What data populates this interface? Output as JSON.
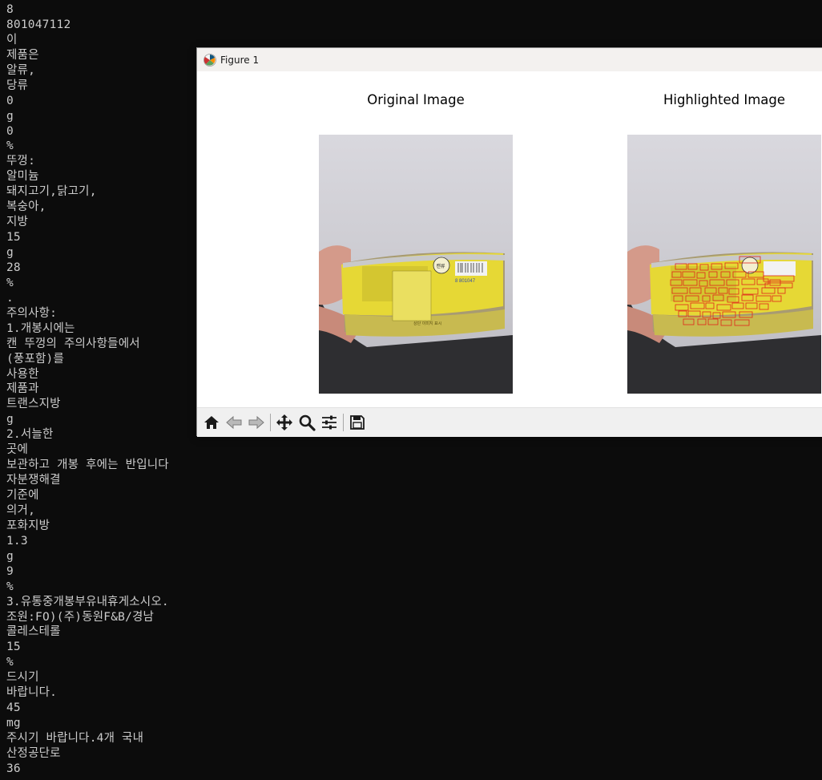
{
  "terminal": {
    "lines": [
      "8",
      "801047112",
      "이",
      "제품은",
      "알류,",
      "당류",
      "0",
      "g",
      "0",
      "%",
      "뚜껑:",
      "알미늄",
      "돼지고기,닭고기,",
      "복숭아,",
      "지방",
      "15",
      "g",
      "28",
      "%",
      ".",
      "주의사항:",
      "1.개봉시에는",
      "캔 뚜껑의 주의사항들에서",
      "(풍포함)를",
      "사용한",
      "제품과",
      "트랜스지방",
      "g",
      "2.서늘한",
      "곳에",
      "보관하고 개봉 후에는 반입니다",
      "자분쟁해결",
      "기준에",
      "의거,",
      "포화지방",
      "1.3",
      "g",
      "9",
      "%",
      "3.유통중개봉부유내휴게소시오.",
      "조원:FO)(주)동원F&B/경남",
      "콜레스테롤",
      "15",
      "%",
      "드시기",
      "바랍니다.",
      "45",
      "mg",
      "주시기 바랍니다.4개 국내",
      "산정공단로",
      "36"
    ]
  },
  "figure": {
    "window_title": "Figure 1",
    "app_icon": "matplotlib-figure-icon",
    "subplots": [
      {
        "title": "Original Image"
      },
      {
        "title": "Highlighted Image"
      }
    ],
    "image_label_text": {
      "barcode_digits": "8 801047",
      "badge": "캔류",
      "footer": "상단 이미지 표시"
    },
    "toolbar": {
      "buttons": [
        "home-icon",
        "back-icon",
        "forward-icon",
        "pan-icon",
        "zoom-icon",
        "configure-subplots-icon",
        "save-icon"
      ]
    },
    "colors": {
      "can_label": "#e6d835",
      "highlight_box": "#e0241b",
      "terminal_text": "#cccccc",
      "terminal_bg": "#0c0c0c"
    }
  }
}
